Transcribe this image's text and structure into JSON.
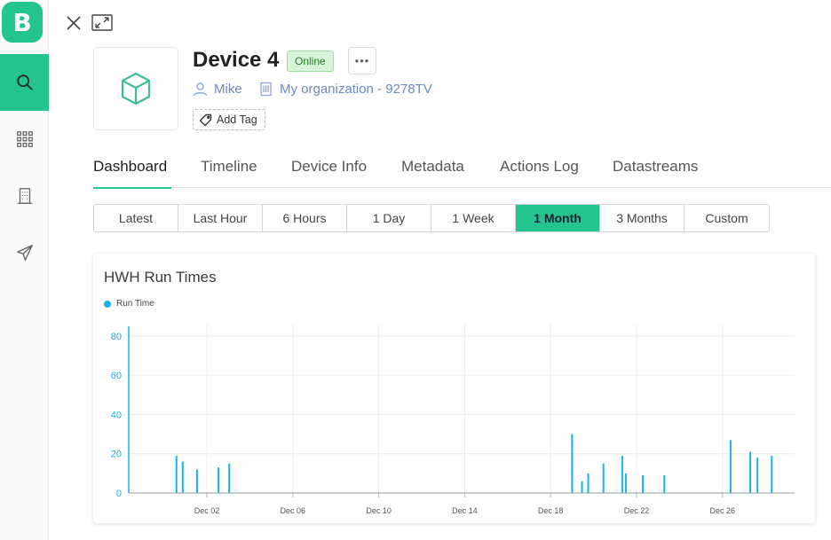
{
  "app": {
    "logo_letter": "B"
  },
  "sidebar": {
    "items": [
      {
        "icon": "search-icon",
        "active": true
      },
      {
        "icon": "grid-icon",
        "active": false
      },
      {
        "icon": "building-icon",
        "active": false
      },
      {
        "icon": "send-icon",
        "active": false
      }
    ]
  },
  "top_icons": [
    "close-icon",
    "minimize-icon"
  ],
  "device": {
    "name": "Device 4",
    "status": "Online",
    "more_label": "•••",
    "owner": "Mike",
    "organization": "My organization - 9278TV",
    "add_tag_label": "Add Tag",
    "icon": "cube-icon"
  },
  "tabs": [
    {
      "label": "Dashboard",
      "active": true
    },
    {
      "label": "Timeline",
      "active": false
    },
    {
      "label": "Device Info",
      "active": false
    },
    {
      "label": "Metadata",
      "active": false
    },
    {
      "label": "Actions Log",
      "active": false
    },
    {
      "label": "Datastreams",
      "active": false
    }
  ],
  "ranges": [
    {
      "label": "Latest",
      "active": false
    },
    {
      "label": "Last Hour",
      "active": false
    },
    {
      "label": "6 Hours",
      "active": false
    },
    {
      "label": "1 Day",
      "active": false
    },
    {
      "label": "1 Week",
      "active": false
    },
    {
      "label": "1 Month",
      "active": true
    },
    {
      "label": "3 Months",
      "active": false
    },
    {
      "label": "Custom",
      "active": false
    }
  ],
  "colors": {
    "accent": "#23c48e",
    "series": "#1ab3e6",
    "status_bg": "#d6f5d6",
    "link": "#6d8bbd"
  },
  "chart_data": {
    "type": "bar",
    "title": "HWH Run Times",
    "legend": [
      "Run Time"
    ],
    "legend_position": "top-left",
    "grid": true,
    "ylim": [
      0,
      84
    ],
    "yticks": [
      0,
      20,
      40,
      60,
      80
    ],
    "x_ticks": [
      "Dec 02",
      "Dec 06",
      "Dec 10",
      "Dec 14",
      "Dec 18",
      "Dec 22",
      "Dec 26"
    ],
    "series": [
      {
        "name": "Run Time",
        "points": [
          {
            "x": "Nov 30 14:00",
            "y": 19
          },
          {
            "x": "Nov 30 21:00",
            "y": 16
          },
          {
            "x": "Dec 01 13:00",
            "y": 12
          },
          {
            "x": "Dec 02 13:00",
            "y": 13
          },
          {
            "x": "Dec 03 01:00",
            "y": 15
          },
          {
            "x": "Dec 19 00:00",
            "y": 30
          },
          {
            "x": "Dec 19 11:00",
            "y": 6
          },
          {
            "x": "Dec 19 18:00",
            "y": 10
          },
          {
            "x": "Dec 20 11:00",
            "y": 15
          },
          {
            "x": "Dec 21 08:00",
            "y": 19
          },
          {
            "x": "Dec 21 12:00",
            "y": 10
          },
          {
            "x": "Dec 22 07:00",
            "y": 9
          },
          {
            "x": "Dec 23 07:00",
            "y": 9
          },
          {
            "x": "Dec 26 09:00",
            "y": 27
          },
          {
            "x": "Dec 27 07:00",
            "y": 21
          },
          {
            "x": "Dec 27 15:00",
            "y": 18
          },
          {
            "x": "Dec 28 07:00",
            "y": 19
          }
        ]
      }
    ]
  }
}
